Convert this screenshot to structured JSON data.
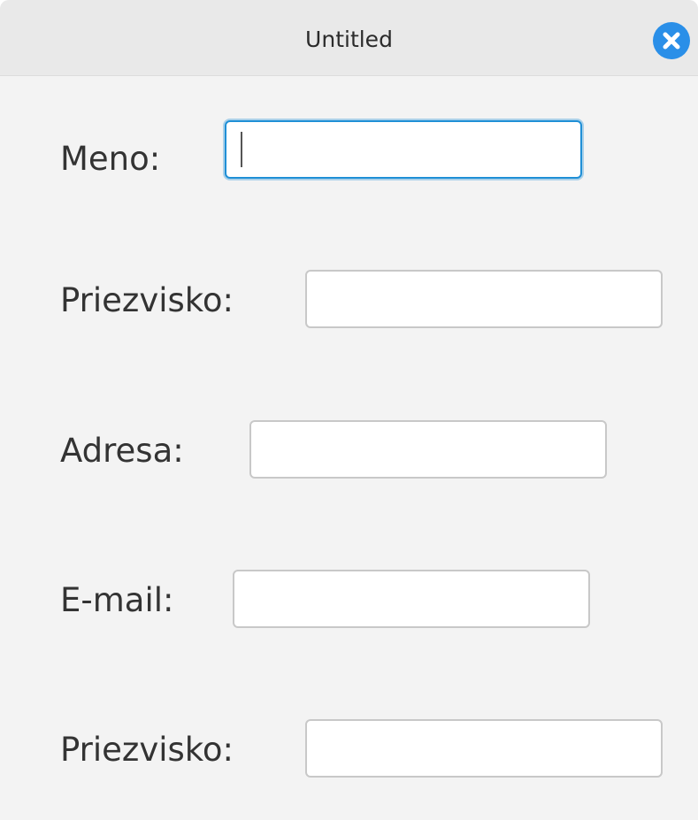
{
  "window": {
    "title": "Untitled"
  },
  "form": {
    "fields": [
      {
        "label": "Meno:",
        "value": "",
        "placeholder": "",
        "focused": true
      },
      {
        "label": "Priezvisko:",
        "value": "",
        "placeholder": "",
        "focused": false
      },
      {
        "label": "Adresa:",
        "value": "",
        "placeholder": "",
        "focused": false
      },
      {
        "label": "E-mail:",
        "value": "",
        "placeholder": "",
        "focused": false
      },
      {
        "label": "Priezvisko:",
        "value": "",
        "placeholder": "",
        "focused": false
      }
    ]
  },
  "icons": {
    "close": "close-icon"
  },
  "colors": {
    "accent": "#2a8fe8",
    "focus_border": "#1f8fd6",
    "titlebar": "#e9e9e9",
    "background": "#f3f3f3"
  }
}
